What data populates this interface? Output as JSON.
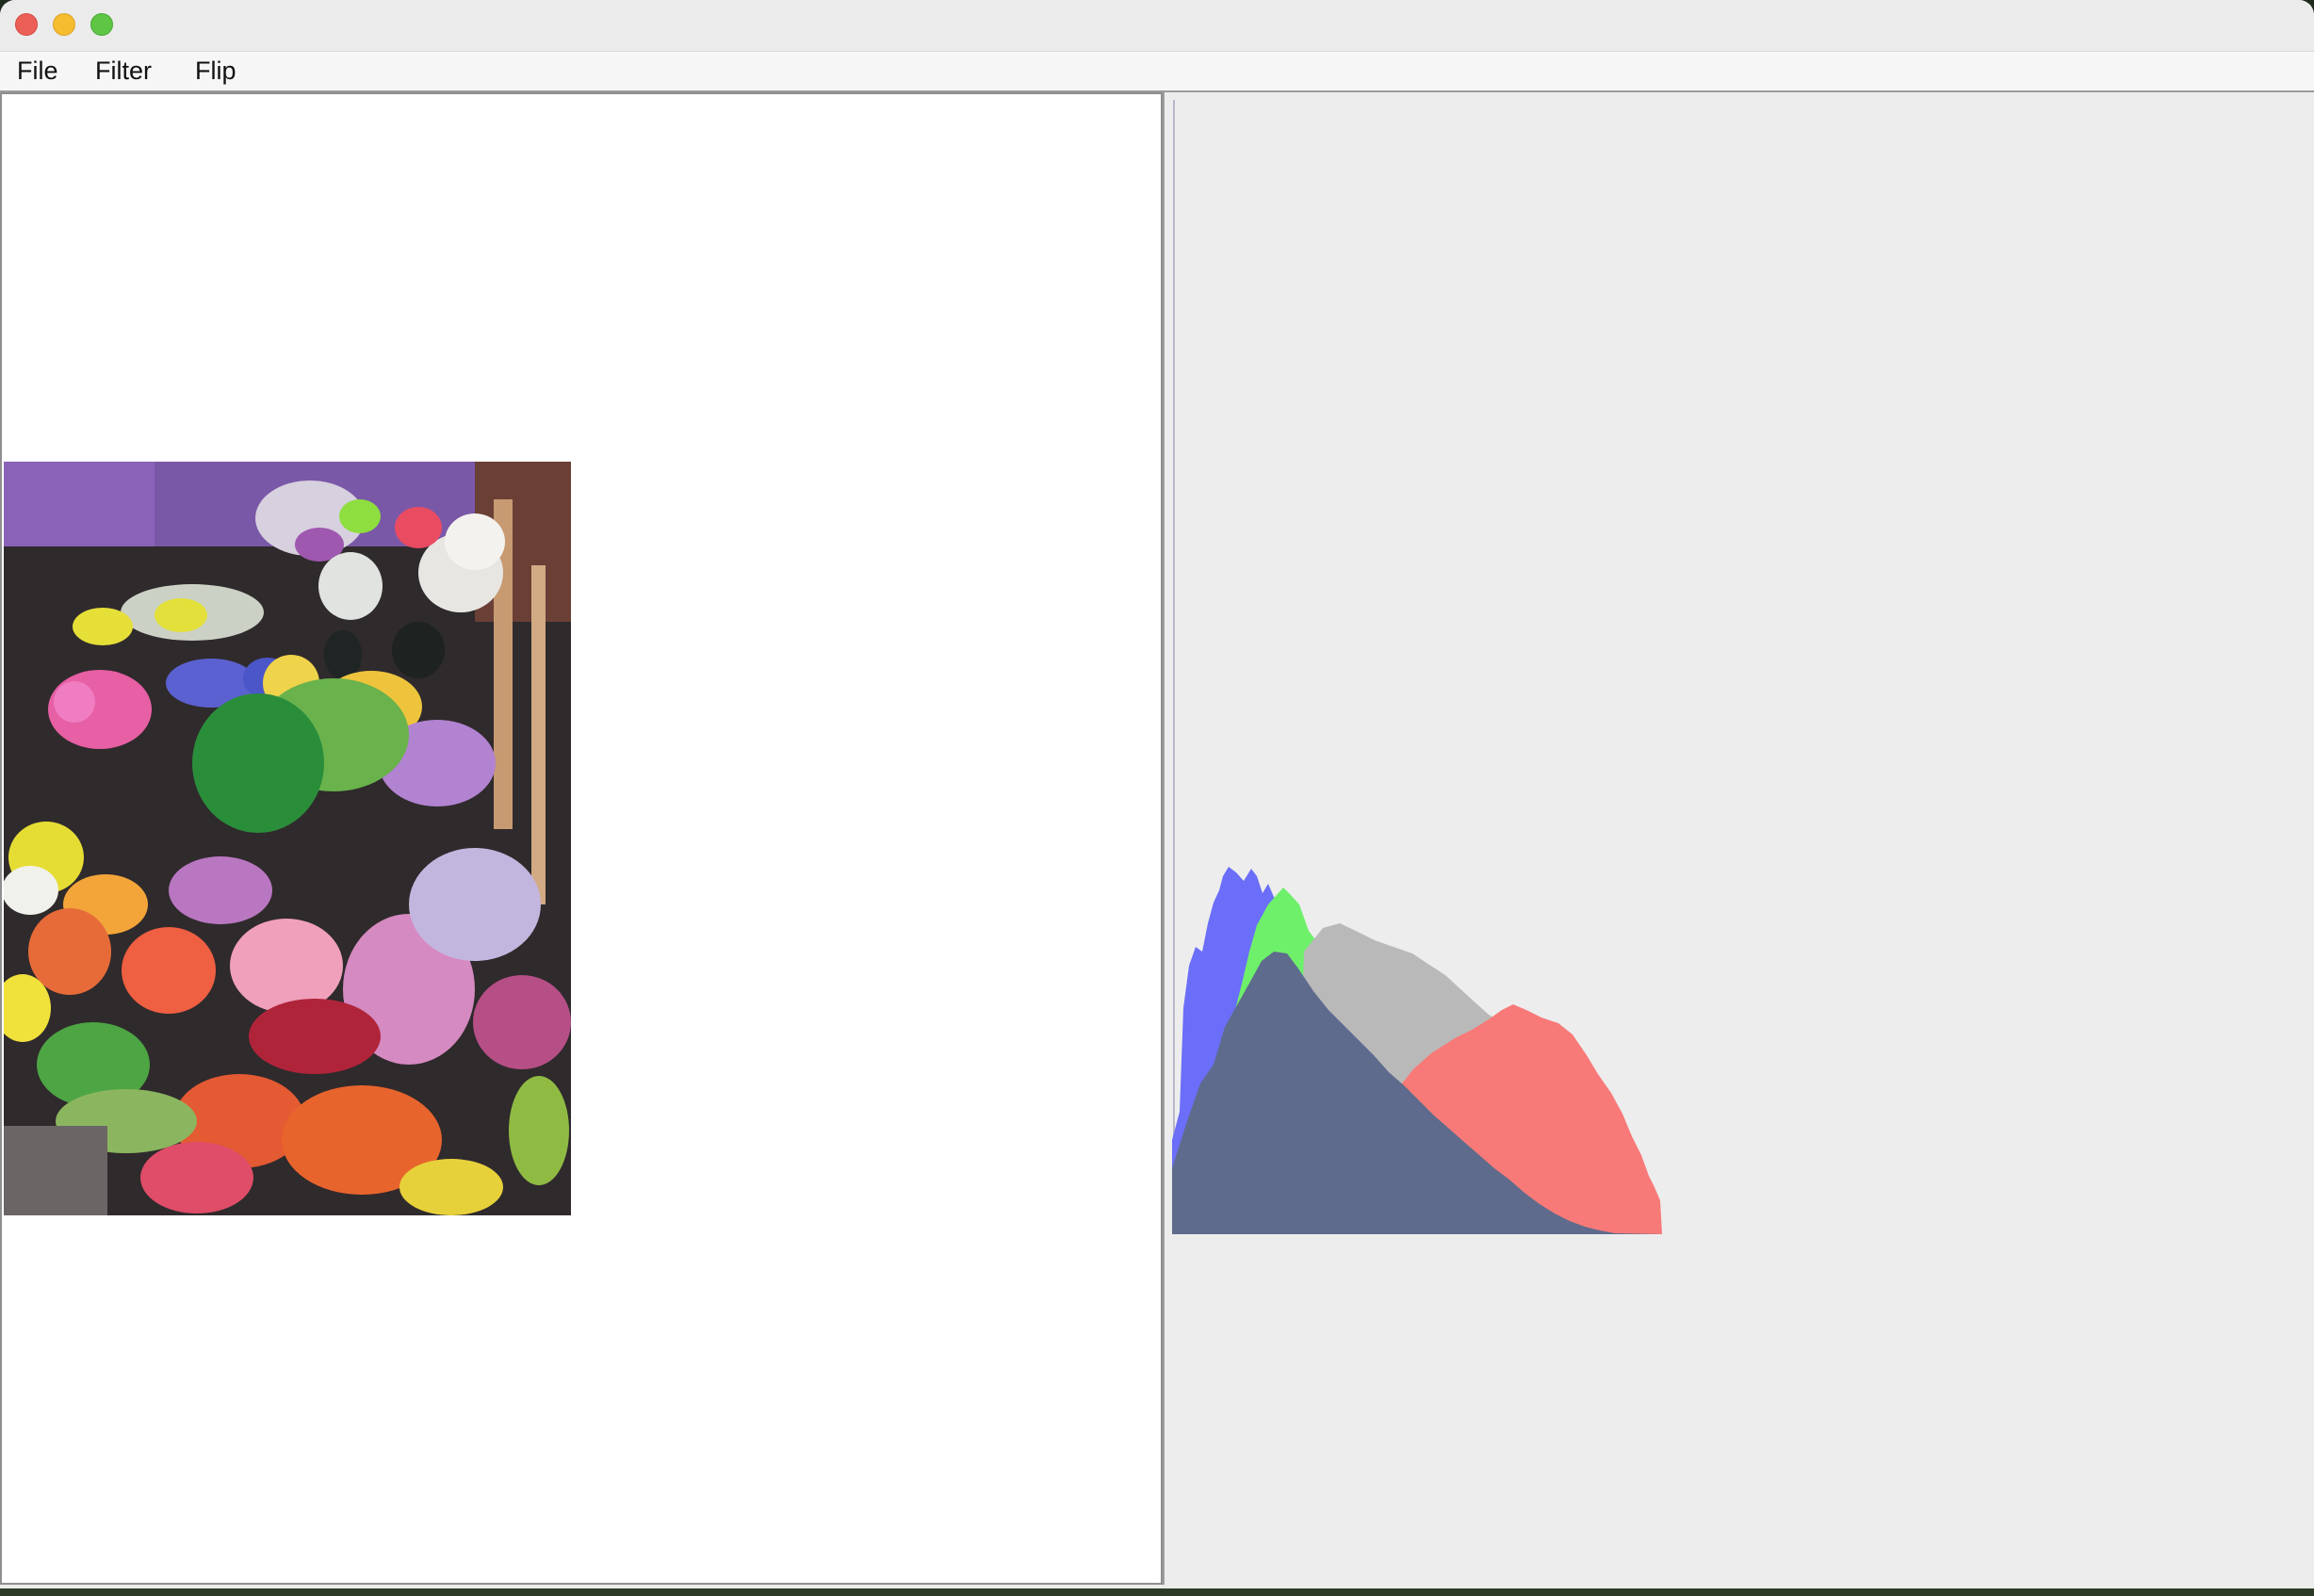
{
  "window": {
    "controls": {
      "close": "close-icon",
      "minimize": "minimize-icon",
      "zoom": "zoom-icon"
    }
  },
  "menu": {
    "file": "File",
    "filter": "Filter",
    "flip": "Flip"
  },
  "image": {
    "description": "flower-market-photo"
  },
  "histogram": {
    "colors": {
      "red": "#f87a78",
      "green": "#6ef06a",
      "blue": "#6b6ef8",
      "gray": "#b9b9b9",
      "overlap": "#5e6b8c"
    }
  }
}
